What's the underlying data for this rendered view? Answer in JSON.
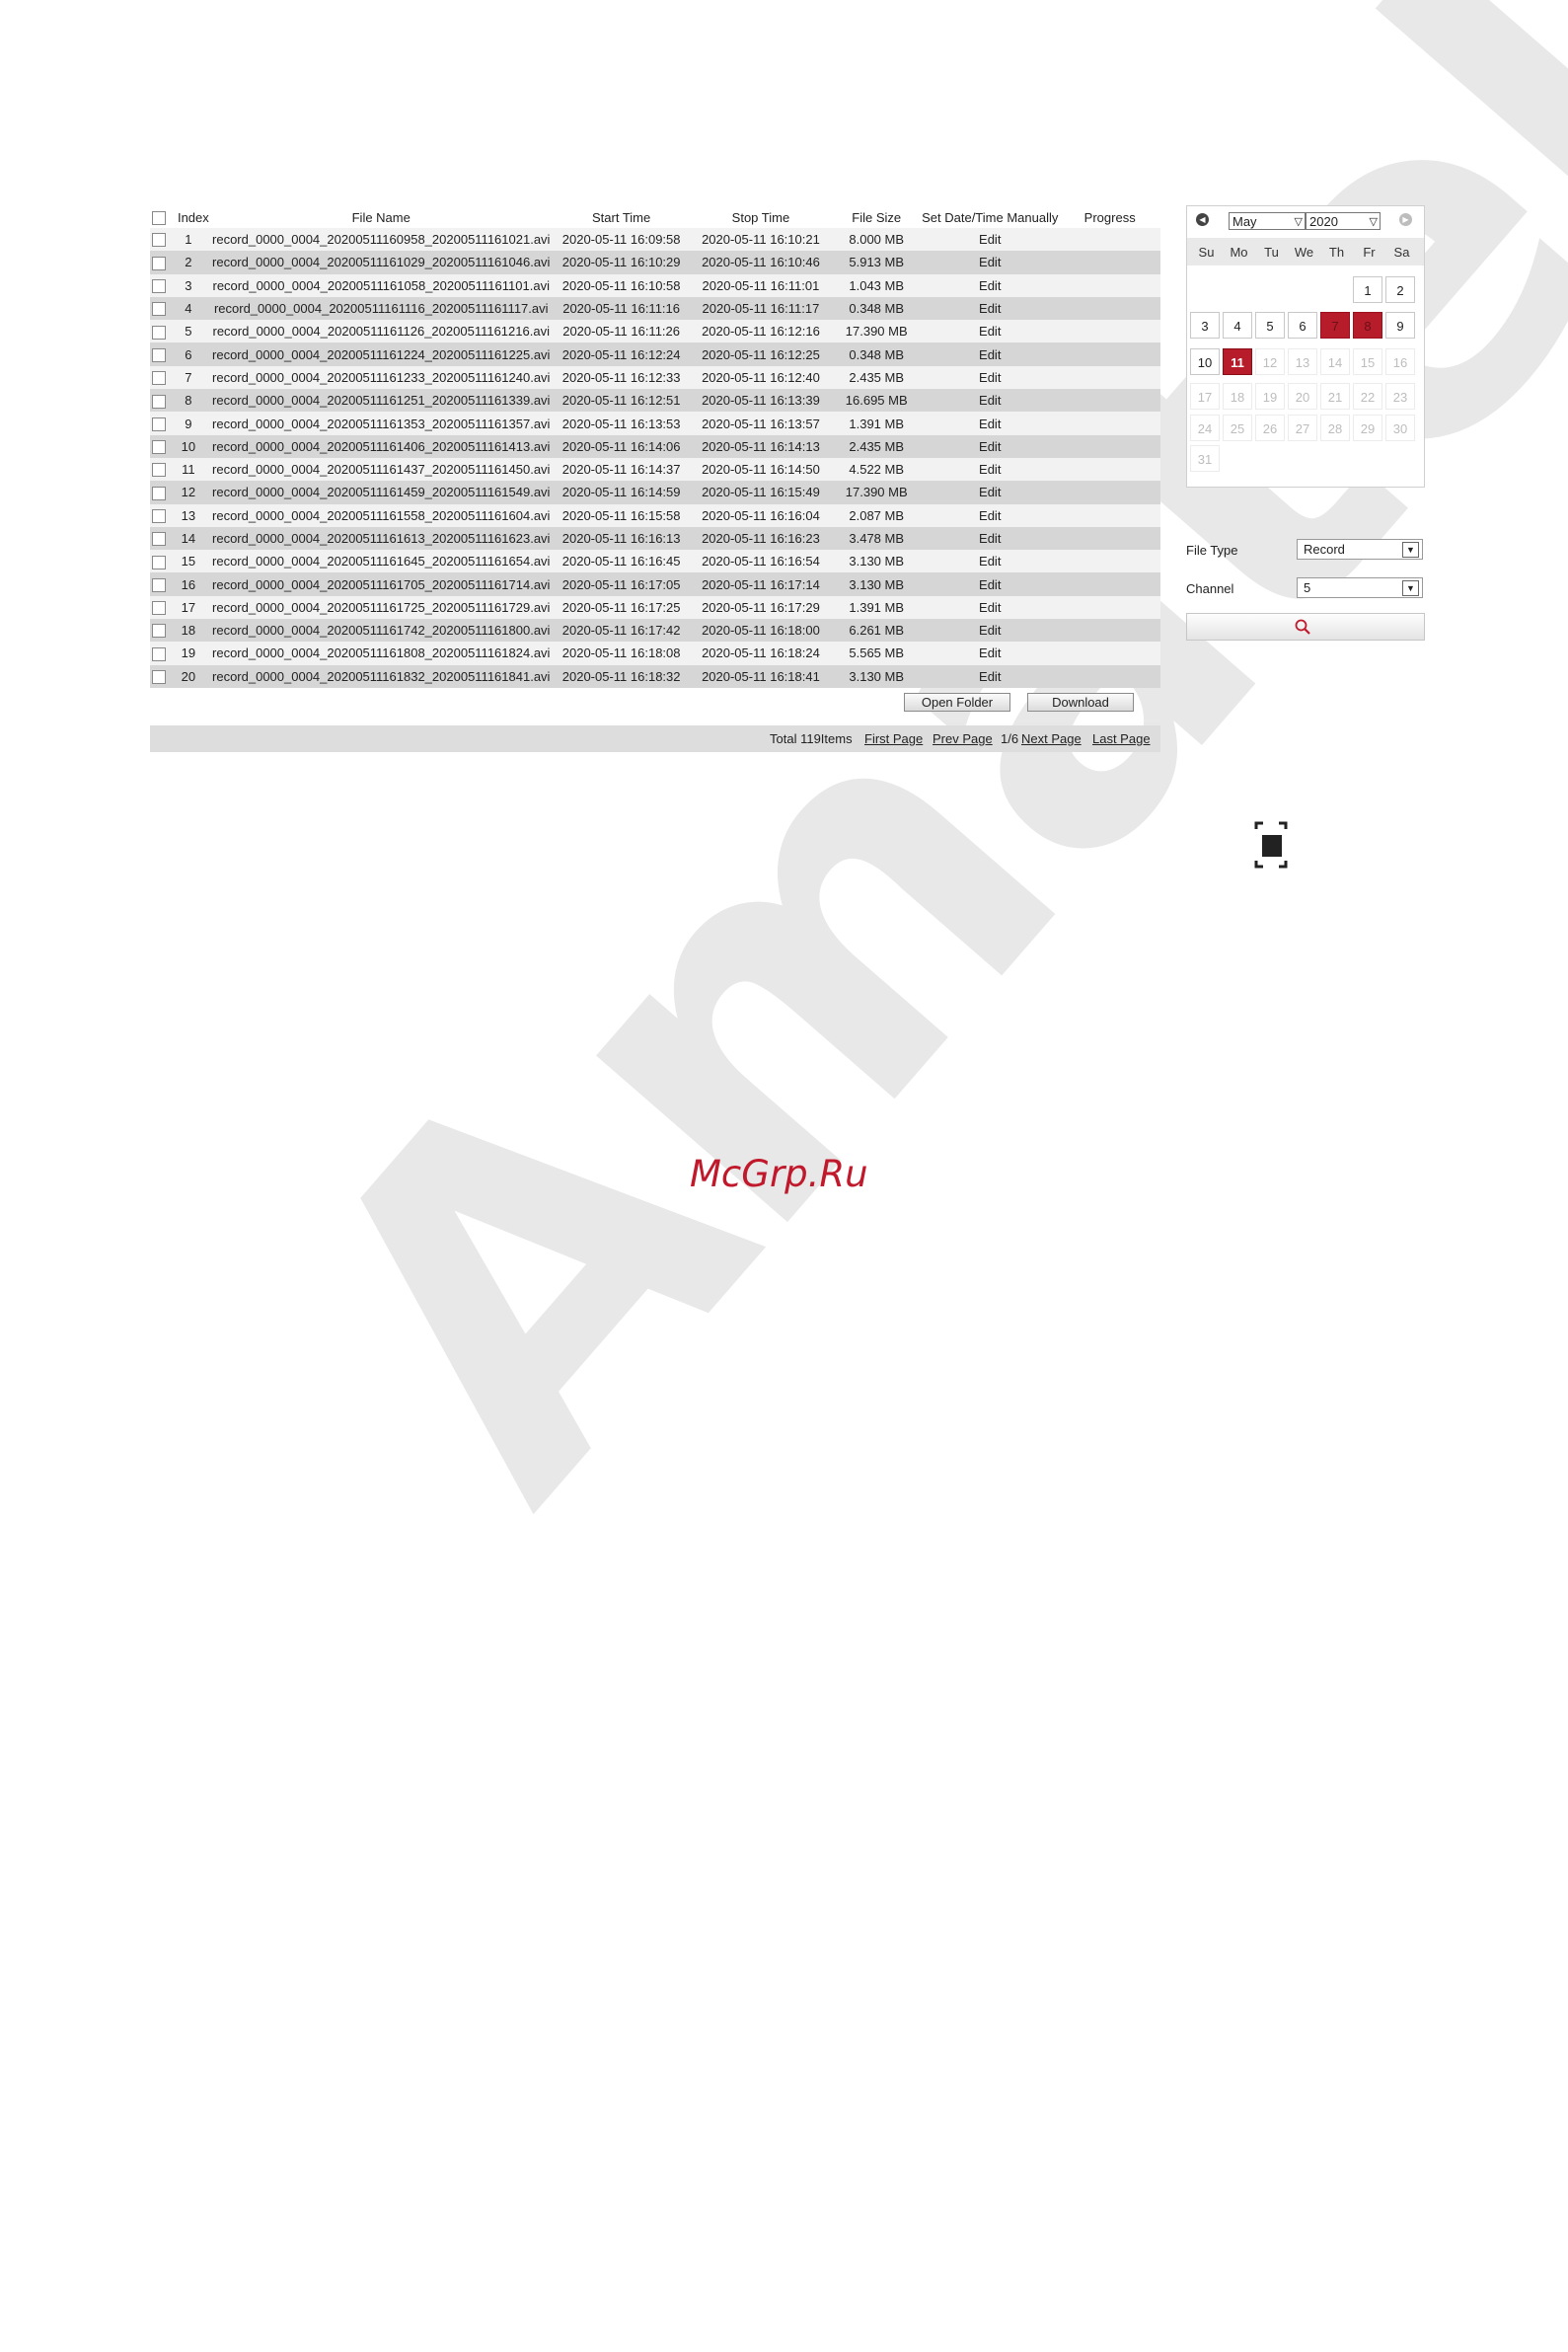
{
  "table": {
    "headers": [
      "Index",
      "File Name",
      "Start Time",
      "Stop Time",
      "File Size",
      "Set Date/Time Manually",
      "Progress"
    ],
    "rows": [
      {
        "index": "1",
        "file": "record_0000_0004_20200511160958_20200511161021.avi",
        "start": "2020-05-11 16:09:58",
        "stop": "2020-05-11 16:10:21",
        "size": "8.000 MB",
        "edit": "Edit"
      },
      {
        "index": "2",
        "file": "record_0000_0004_20200511161029_20200511161046.avi",
        "start": "2020-05-11 16:10:29",
        "stop": "2020-05-11 16:10:46",
        "size": "5.913 MB",
        "edit": "Edit"
      },
      {
        "index": "3",
        "file": "record_0000_0004_20200511161058_20200511161101.avi",
        "start": "2020-05-11 16:10:58",
        "stop": "2020-05-11 16:11:01",
        "size": "1.043 MB",
        "edit": "Edit"
      },
      {
        "index": "4",
        "file": "record_0000_0004_20200511161116_20200511161117.avi",
        "start": "2020-05-11 16:11:16",
        "stop": "2020-05-11 16:11:17",
        "size": "0.348 MB",
        "edit": "Edit"
      },
      {
        "index": "5",
        "file": "record_0000_0004_20200511161126_20200511161216.avi",
        "start": "2020-05-11 16:11:26",
        "stop": "2020-05-11 16:12:16",
        "size": "17.390 MB",
        "edit": "Edit"
      },
      {
        "index": "6",
        "file": "record_0000_0004_20200511161224_20200511161225.avi",
        "start": "2020-05-11 16:12:24",
        "stop": "2020-05-11 16:12:25",
        "size": "0.348 MB",
        "edit": "Edit"
      },
      {
        "index": "7",
        "file": "record_0000_0004_20200511161233_20200511161240.avi",
        "start": "2020-05-11 16:12:33",
        "stop": "2020-05-11 16:12:40",
        "size": "2.435 MB",
        "edit": "Edit"
      },
      {
        "index": "8",
        "file": "record_0000_0004_20200511161251_20200511161339.avi",
        "start": "2020-05-11 16:12:51",
        "stop": "2020-05-11 16:13:39",
        "size": "16.695 MB",
        "edit": "Edit"
      },
      {
        "index": "9",
        "file": "record_0000_0004_20200511161353_20200511161357.avi",
        "start": "2020-05-11 16:13:53",
        "stop": "2020-05-11 16:13:57",
        "size": "1.391 MB",
        "edit": "Edit"
      },
      {
        "index": "10",
        "file": "record_0000_0004_20200511161406_20200511161413.avi",
        "start": "2020-05-11 16:14:06",
        "stop": "2020-05-11 16:14:13",
        "size": "2.435 MB",
        "edit": "Edit"
      },
      {
        "index": "11",
        "file": "record_0000_0004_20200511161437_20200511161450.avi",
        "start": "2020-05-11 16:14:37",
        "stop": "2020-05-11 16:14:50",
        "size": "4.522 MB",
        "edit": "Edit"
      },
      {
        "index": "12",
        "file": "record_0000_0004_20200511161459_20200511161549.avi",
        "start": "2020-05-11 16:14:59",
        "stop": "2020-05-11 16:15:49",
        "size": "17.390 MB",
        "edit": "Edit"
      },
      {
        "index": "13",
        "file": "record_0000_0004_20200511161558_20200511161604.avi",
        "start": "2020-05-11 16:15:58",
        "stop": "2020-05-11 16:16:04",
        "size": "2.087 MB",
        "edit": "Edit"
      },
      {
        "index": "14",
        "file": "record_0000_0004_20200511161613_20200511161623.avi",
        "start": "2020-05-11 16:16:13",
        "stop": "2020-05-11 16:16:23",
        "size": "3.478 MB",
        "edit": "Edit"
      },
      {
        "index": "15",
        "file": "record_0000_0004_20200511161645_20200511161654.avi",
        "start": "2020-05-11 16:16:45",
        "stop": "2020-05-11 16:16:54",
        "size": "3.130 MB",
        "edit": "Edit"
      },
      {
        "index": "16",
        "file": "record_0000_0004_20200511161705_20200511161714.avi",
        "start": "2020-05-11 16:17:05",
        "stop": "2020-05-11 16:17:14",
        "size": "3.130 MB",
        "edit": "Edit"
      },
      {
        "index": "17",
        "file": "record_0000_0004_20200511161725_20200511161729.avi",
        "start": "2020-05-11 16:17:25",
        "stop": "2020-05-11 16:17:29",
        "size": "1.391 MB",
        "edit": "Edit"
      },
      {
        "index": "18",
        "file": "record_0000_0004_20200511161742_20200511161800.avi",
        "start": "2020-05-11 16:17:42",
        "stop": "2020-05-11 16:18:00",
        "size": "6.261 MB",
        "edit": "Edit"
      },
      {
        "index": "19",
        "file": "record_0000_0004_20200511161808_20200511161824.avi",
        "start": "2020-05-11 16:18:08",
        "stop": "2020-05-11 16:18:24",
        "size": "5.565 MB",
        "edit": "Edit"
      },
      {
        "index": "20",
        "file": "record_0000_0004_20200511161832_20200511161841.avi",
        "start": "2020-05-11 16:18:32",
        "stop": "2020-05-11 16:18:41",
        "size": "3.130 MB",
        "edit": "Edit"
      }
    ]
  },
  "buttons": {
    "open_folder": "Open Folder",
    "download": "Download"
  },
  "pager": {
    "total": "Total 119Items",
    "first": "First Page",
    "prev": "Prev Page",
    "page": "1/6",
    "next": "Next Page",
    "last": "Last Page"
  },
  "calendar": {
    "month": "May",
    "year": "2020",
    "weekdays": [
      "Su",
      "Mo",
      "Tu",
      "We",
      "Th",
      "Fr",
      "Sa"
    ],
    "record_days": [
      "7",
      "8"
    ],
    "selected_day": "11",
    "colors": {
      "record": "#b71c2b",
      "selected": "#b71c2b"
    }
  },
  "filters": {
    "file_type_label": "File Type",
    "file_type_value": "Record",
    "channel_label": "Channel",
    "channel_value": "5"
  },
  "icons": {
    "search": "search-icon",
    "fullscreen": "fullscreen-icon",
    "prev_month": "chevron-left-icon",
    "next_month": "chevron-right-icon"
  },
  "footer": {
    "brand": "McGrp.Ru",
    "watermark": "Amatek"
  }
}
